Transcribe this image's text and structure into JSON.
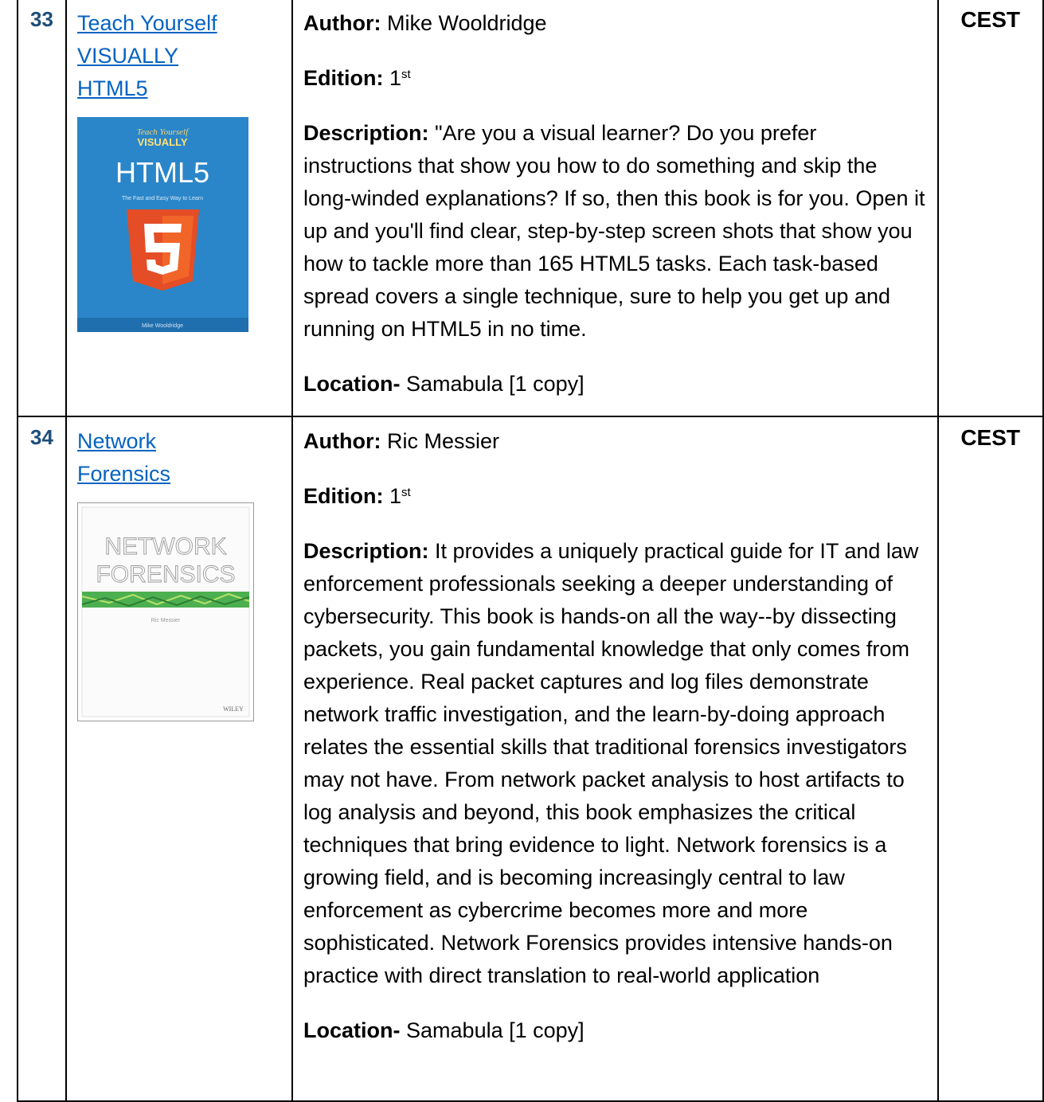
{
  "rows": [
    {
      "number": "33",
      "title_lines": [
        "Teach Yourself",
        "VISUALLY",
        "HTML5"
      ],
      "author_label": "Author:",
      "author": "Mike Wooldridge",
      "edition_label": "Edition:",
      "edition": "1",
      "edition_sup": "st",
      "description_label": "Description:",
      "description": "\"Are you a visual learner? Do you prefer instructions that show you how to do something and skip the long-winded explanations? If so, then this book is for you. Open it up and you'll find clear, step-by-step screen shots that show you how to tackle more than 165 HTML5 tasks. Each task-based spread covers a single technique, sure to help you get up and running on HTML5 in no time.",
      "location_label": "Location-",
      "location": "Samabula [1 copy]",
      "department": "CEST",
      "cover": {
        "brand": "Teach Yourself",
        "brand2": "VISUALLY",
        "title": "HTML5",
        "subtitle": "The Fast and Easy Way to Learn",
        "author": "Mike Wooldridge",
        "bg": "#2a86c8",
        "shield": "#e44d26"
      }
    },
    {
      "number": "34",
      "title_lines": [
        "Network",
        "Forensics"
      ],
      "author_label": "Author:",
      "author": "Ric Messier",
      "edition_label": "Edition:",
      "edition": "1",
      "edition_sup": "st",
      "description_label": "Description:",
      "description": "It provides a uniquely practical guide for IT and law enforcement professionals seeking a deeper understanding of cybersecurity. This book is hands-on all the way--by dissecting packets, you gain fundamental knowledge that only comes from experience. Real packet captures and log files demonstrate network traffic investigation, and the learn-by-doing approach relates the essential skills that traditional forensics investigators may not have. From network packet analysis to host artifacts to log analysis and beyond, this book emphasizes the critical techniques that bring evidence to light. Network forensics is a growing field, and is becoming increasingly central to law enforcement as cybercrime becomes more and more sophisticated. Network Forensics provides intensive hands-on practice with direct translation to real-world application",
      "location_label": "Location-",
      "location": "Samabula [1 copy]",
      "department": "CEST",
      "cover": {
        "title1": "NETWORK",
        "title2": "FORENSICS",
        "author": "Ric Messier",
        "publisher": "WILEY",
        "band": "#4caf50"
      }
    }
  ]
}
